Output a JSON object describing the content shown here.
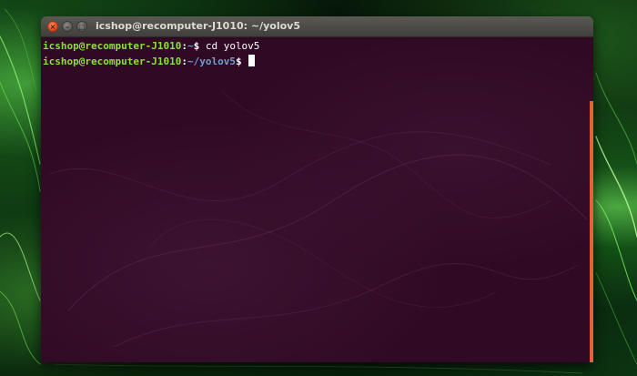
{
  "window": {
    "title": "icshop@recomputer-J1010: ~/yolov5",
    "close_icon": "close-icon",
    "minimize_icon": "minimize-icon",
    "maximize_icon": "maximize-icon"
  },
  "terminal": {
    "lines": [
      {
        "user_host": "icshop@recomputer-J1010",
        "separator": ":",
        "path": "~",
        "prompt": "$",
        "command": " cd yolov5"
      },
      {
        "user_host": "icshop@recomputer-J1010",
        "separator": ":",
        "path": "~/yolov5",
        "prompt": "$",
        "command": ""
      }
    ]
  },
  "colors": {
    "terminal_bg": "#300a24",
    "prompt_user": "#8ae234",
    "prompt_path": "#729fcf",
    "accent_scroll": "#e2603a"
  }
}
